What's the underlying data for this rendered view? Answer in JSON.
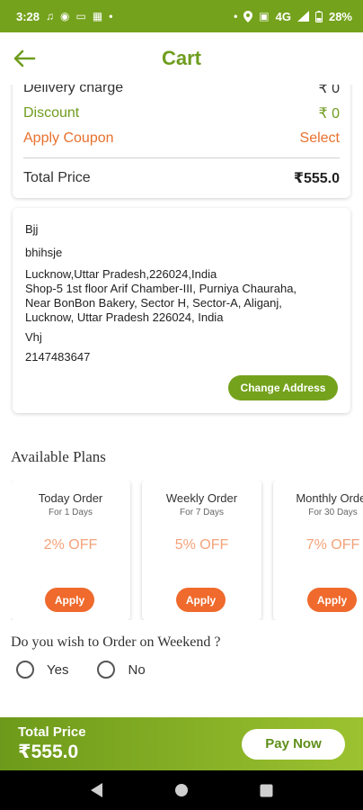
{
  "status_bar": {
    "time": "3:28",
    "network": "4G",
    "battery": "28%"
  },
  "header": {
    "title": "Cart"
  },
  "price_summary": {
    "delivery_label": "Delivery charge",
    "delivery_value": "₹ 0",
    "discount_label": "Discount",
    "discount_value": "₹ 0",
    "coupon_label": "Apply Coupon",
    "coupon_action": "Select",
    "total_label": "Total Price",
    "total_value": "₹555.0"
  },
  "address": {
    "name": "Bjj",
    "line1": "bhihsje",
    "line2": "Lucknow,Uttar Pradesh,226024,India",
    "line3": "Shop-5 1st floor Arif Chamber-III, Purniya Chauraha,",
    "line4": "Near BonBon Bakery, Sector H, Sector-A, Aliganj,",
    "line5": "Lucknow, Uttar Pradesh 226024, India",
    "extra": "Vhj",
    "phone": "2147483647",
    "change_label": "Change Address"
  },
  "plans": {
    "title": "Available Plans",
    "items": [
      {
        "name": "Today Order",
        "days": "For 1 Days",
        "discount": "2% OFF",
        "apply": "Apply"
      },
      {
        "name": "Weekly Order",
        "days": "For 7 Days",
        "discount": "5% OFF",
        "apply": "Apply"
      },
      {
        "name": "Monthly Order",
        "days": "For 30 Days",
        "discount": "7% OFF",
        "apply": "Apply"
      }
    ]
  },
  "weekend": {
    "question": "Do you wish to Order on Weekend ?",
    "yes": "Yes",
    "no": "No"
  },
  "footer": {
    "total_label": "Total Price",
    "total_value": "₹555.0",
    "pay_label": "Pay Now"
  },
  "colors": {
    "brand_green": "#74a21c",
    "accent_orange": "#ef6a2c",
    "discount_text": "#f4a27a"
  }
}
